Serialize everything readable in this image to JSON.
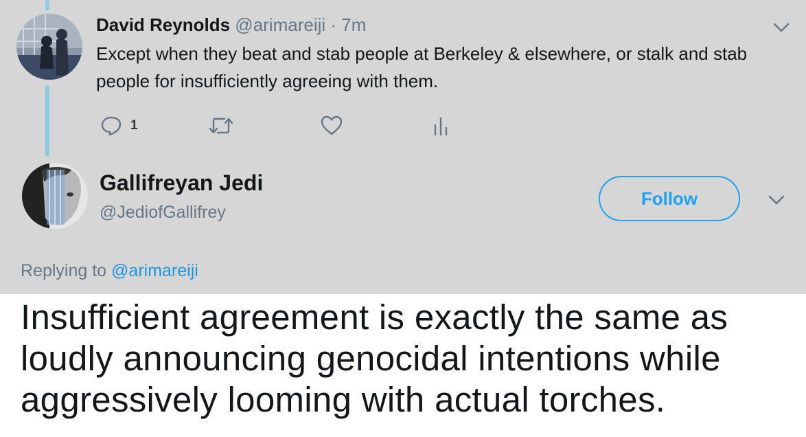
{
  "parent_tweet": {
    "name": "David Reynolds",
    "handle": "@arimareiji",
    "separator": "·",
    "time": "7m",
    "text": "Except when they beat and stab people at Berkeley & elsewhere, or stalk and stab people for insufficiently agreeing with them.",
    "actions": {
      "reply_count": "1",
      "reply_icon": "reply-icon",
      "retweet_icon": "retweet-icon",
      "like_icon": "heart-icon",
      "analytics_icon": "analytics-icon"
    }
  },
  "main_tweet": {
    "name": "Gallifreyan Jedi",
    "handle": "@JediofGallifrey",
    "follow_label": "Follow",
    "replying_prefix": "Replying to",
    "replying_to": "@arimareiji",
    "text": "Insufficient agreement is exactly the same as loudly announcing genocidal intentions while aggressively looming with actual torches."
  },
  "colors": {
    "background_gray": "#d6d6d6",
    "thread_line": "#8ccbe4",
    "accent_blue": "#1da1f2",
    "secondary_text": "#657786"
  }
}
